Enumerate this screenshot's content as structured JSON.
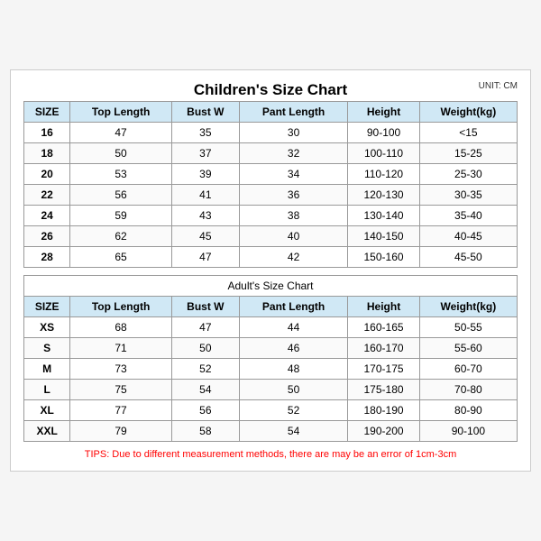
{
  "title": "Children's Size Chart",
  "unit": "UNIT: CM",
  "children": {
    "headers": [
      "SIZE",
      "Top Length",
      "Bust W",
      "Pant Length",
      "Height",
      "Weight(kg)"
    ],
    "rows": [
      [
        "16",
        "47",
        "35",
        "30",
        "90-100",
        "<15"
      ],
      [
        "18",
        "50",
        "37",
        "32",
        "100-110",
        "15-25"
      ],
      [
        "20",
        "53",
        "39",
        "34",
        "110-120",
        "25-30"
      ],
      [
        "22",
        "56",
        "41",
        "36",
        "120-130",
        "30-35"
      ],
      [
        "24",
        "59",
        "43",
        "38",
        "130-140",
        "35-40"
      ],
      [
        "26",
        "62",
        "45",
        "40",
        "140-150",
        "40-45"
      ],
      [
        "28",
        "65",
        "47",
        "42",
        "150-160",
        "45-50"
      ]
    ]
  },
  "adult": {
    "section_title": "Adult's Size Chart",
    "headers": [
      "SIZE",
      "Top Length",
      "Bust W",
      "Pant Length",
      "Height",
      "Weight(kg)"
    ],
    "rows": [
      [
        "XS",
        "68",
        "47",
        "44",
        "160-165",
        "50-55"
      ],
      [
        "S",
        "71",
        "50",
        "46",
        "160-170",
        "55-60"
      ],
      [
        "M",
        "73",
        "52",
        "48",
        "170-175",
        "60-70"
      ],
      [
        "L",
        "75",
        "54",
        "50",
        "175-180",
        "70-80"
      ],
      [
        "XL",
        "77",
        "56",
        "52",
        "180-190",
        "80-90"
      ],
      [
        "XXL",
        "79",
        "58",
        "54",
        "190-200",
        "90-100"
      ]
    ]
  },
  "tips": "TIPS: Due to different measurement methods, there are may be an error of 1cm-3cm"
}
